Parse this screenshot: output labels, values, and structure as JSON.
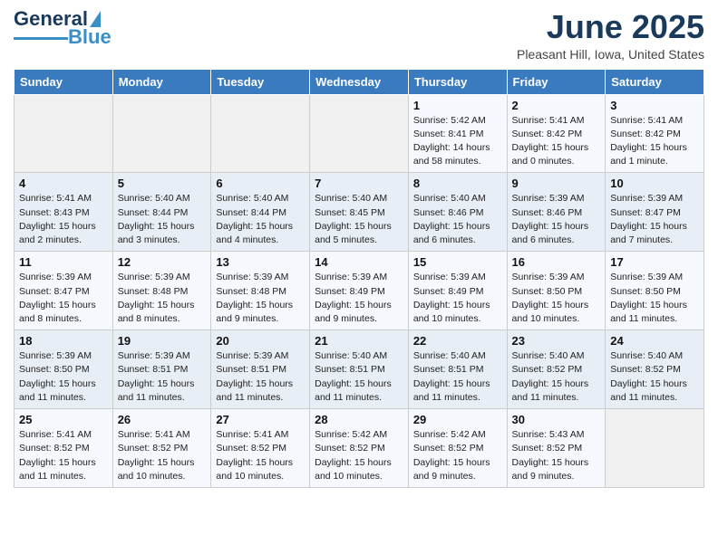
{
  "header": {
    "logo_text_general": "General",
    "logo_text_blue": "Blue",
    "main_title": "June 2025",
    "subtitle": "Pleasant Hill, Iowa, United States"
  },
  "calendar": {
    "weekdays": [
      "Sunday",
      "Monday",
      "Tuesday",
      "Wednesday",
      "Thursday",
      "Friday",
      "Saturday"
    ],
    "weeks": [
      [
        null,
        null,
        null,
        null,
        {
          "day": 1,
          "sunrise": "5:42 AM",
          "sunset": "8:41 PM",
          "daylight": "14 hours and 58 minutes"
        },
        {
          "day": 2,
          "sunrise": "5:41 AM",
          "sunset": "8:42 PM",
          "daylight": "15 hours and 0 minutes"
        },
        {
          "day": 3,
          "sunrise": "5:41 AM",
          "sunset": "8:42 PM",
          "daylight": "15 hours and 1 minute"
        },
        {
          "day": 4,
          "sunrise": "5:41 AM",
          "sunset": "8:43 PM",
          "daylight": "15 hours and 2 minutes"
        },
        {
          "day": 5,
          "sunrise": "5:40 AM",
          "sunset": "8:44 PM",
          "daylight": "15 hours and 3 minutes"
        },
        {
          "day": 6,
          "sunrise": "5:40 AM",
          "sunset": "8:44 PM",
          "daylight": "15 hours and 4 minutes"
        },
        {
          "day": 7,
          "sunrise": "5:40 AM",
          "sunset": "8:45 PM",
          "daylight": "15 hours and 5 minutes"
        }
      ],
      [
        {
          "day": 8,
          "sunrise": "5:40 AM",
          "sunset": "8:46 PM",
          "daylight": "15 hours and 6 minutes"
        },
        {
          "day": 9,
          "sunrise": "5:39 AM",
          "sunset": "8:46 PM",
          "daylight": "15 hours and 6 minutes"
        },
        {
          "day": 10,
          "sunrise": "5:39 AM",
          "sunset": "8:47 PM",
          "daylight": "15 hours and 7 minutes"
        },
        {
          "day": 11,
          "sunrise": "5:39 AM",
          "sunset": "8:47 PM",
          "daylight": "15 hours and 8 minutes"
        },
        {
          "day": 12,
          "sunrise": "5:39 AM",
          "sunset": "8:48 PM",
          "daylight": "15 hours and 8 minutes"
        },
        {
          "day": 13,
          "sunrise": "5:39 AM",
          "sunset": "8:48 PM",
          "daylight": "15 hours and 9 minutes"
        },
        {
          "day": 14,
          "sunrise": "5:39 AM",
          "sunset": "8:49 PM",
          "daylight": "15 hours and 9 minutes"
        }
      ],
      [
        {
          "day": 15,
          "sunrise": "5:39 AM",
          "sunset": "8:49 PM",
          "daylight": "15 hours and 10 minutes"
        },
        {
          "day": 16,
          "sunrise": "5:39 AM",
          "sunset": "8:50 PM",
          "daylight": "15 hours and 10 minutes"
        },
        {
          "day": 17,
          "sunrise": "5:39 AM",
          "sunset": "8:50 PM",
          "daylight": "15 hours and 11 minutes"
        },
        {
          "day": 18,
          "sunrise": "5:39 AM",
          "sunset": "8:50 PM",
          "daylight": "15 hours and 11 minutes"
        },
        {
          "day": 19,
          "sunrise": "5:39 AM",
          "sunset": "8:51 PM",
          "daylight": "15 hours and 11 minutes"
        },
        {
          "day": 20,
          "sunrise": "5:39 AM",
          "sunset": "8:51 PM",
          "daylight": "15 hours and 11 minutes"
        },
        {
          "day": 21,
          "sunrise": "5:40 AM",
          "sunset": "8:51 PM",
          "daylight": "15 hours and 11 minutes"
        }
      ],
      [
        {
          "day": 22,
          "sunrise": "5:40 AM",
          "sunset": "8:51 PM",
          "daylight": "15 hours and 11 minutes"
        },
        {
          "day": 23,
          "sunrise": "5:40 AM",
          "sunset": "8:52 PM",
          "daylight": "15 hours and 11 minutes"
        },
        {
          "day": 24,
          "sunrise": "5:40 AM",
          "sunset": "8:52 PM",
          "daylight": "15 hours and 11 minutes"
        },
        {
          "day": 25,
          "sunrise": "5:41 AM",
          "sunset": "8:52 PM",
          "daylight": "15 hours and 11 minutes"
        },
        {
          "day": 26,
          "sunrise": "5:41 AM",
          "sunset": "8:52 PM",
          "daylight": "15 hours and 10 minutes"
        },
        {
          "day": 27,
          "sunrise": "5:41 AM",
          "sunset": "8:52 PM",
          "daylight": "15 hours and 10 minutes"
        },
        {
          "day": 28,
          "sunrise": "5:42 AM",
          "sunset": "8:52 PM",
          "daylight": "15 hours and 10 minutes"
        }
      ],
      [
        {
          "day": 29,
          "sunrise": "5:42 AM",
          "sunset": "8:52 PM",
          "daylight": "15 hours and 9 minutes"
        },
        {
          "day": 30,
          "sunrise": "5:43 AM",
          "sunset": "8:52 PM",
          "daylight": "15 hours and 9 minutes"
        },
        null,
        null,
        null,
        null,
        null
      ]
    ]
  }
}
